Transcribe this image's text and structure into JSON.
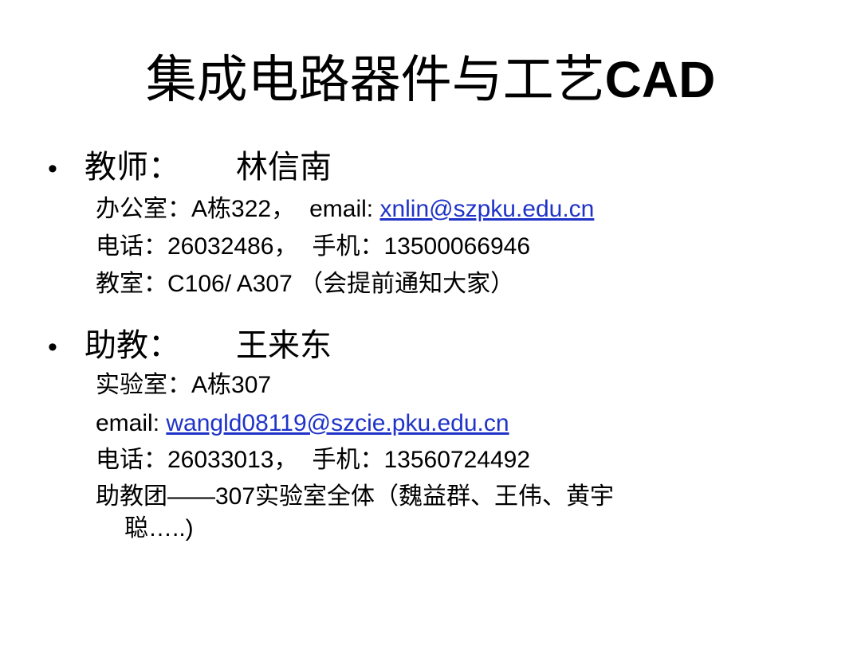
{
  "title": {
    "cjk": "集成电路器件与工艺",
    "latin": "CAD"
  },
  "teacher": {
    "bullet": "•",
    "label": "教师：",
    "name": "林信南",
    "office_label": "办公室：A栋322，",
    "email_label": "email: ",
    "email": "xnlin@szpku.edu.cn",
    "phone_label": "电话：26032486，",
    "mobile_label": "手机：13500066946",
    "classroom": "教室：C106/ A307 （会提前通知大家）"
  },
  "assistant": {
    "bullet": "•",
    "label": "助教：",
    "name": "王来东",
    "lab": "实验室：A栋307",
    "email_label": "email: ",
    "email": "wangld08119@szcie.pku.edu.cn",
    "phone_label": "电话：26033013，",
    "mobile_label": "手机：13560724492",
    "team_line1": "助教团——307实验室全体（魏益群、王伟、黄宇",
    "team_line2": "聪…..)"
  },
  "colors": {
    "link": "#1f33c8",
    "text": "#000000",
    "background": "#ffffff"
  }
}
